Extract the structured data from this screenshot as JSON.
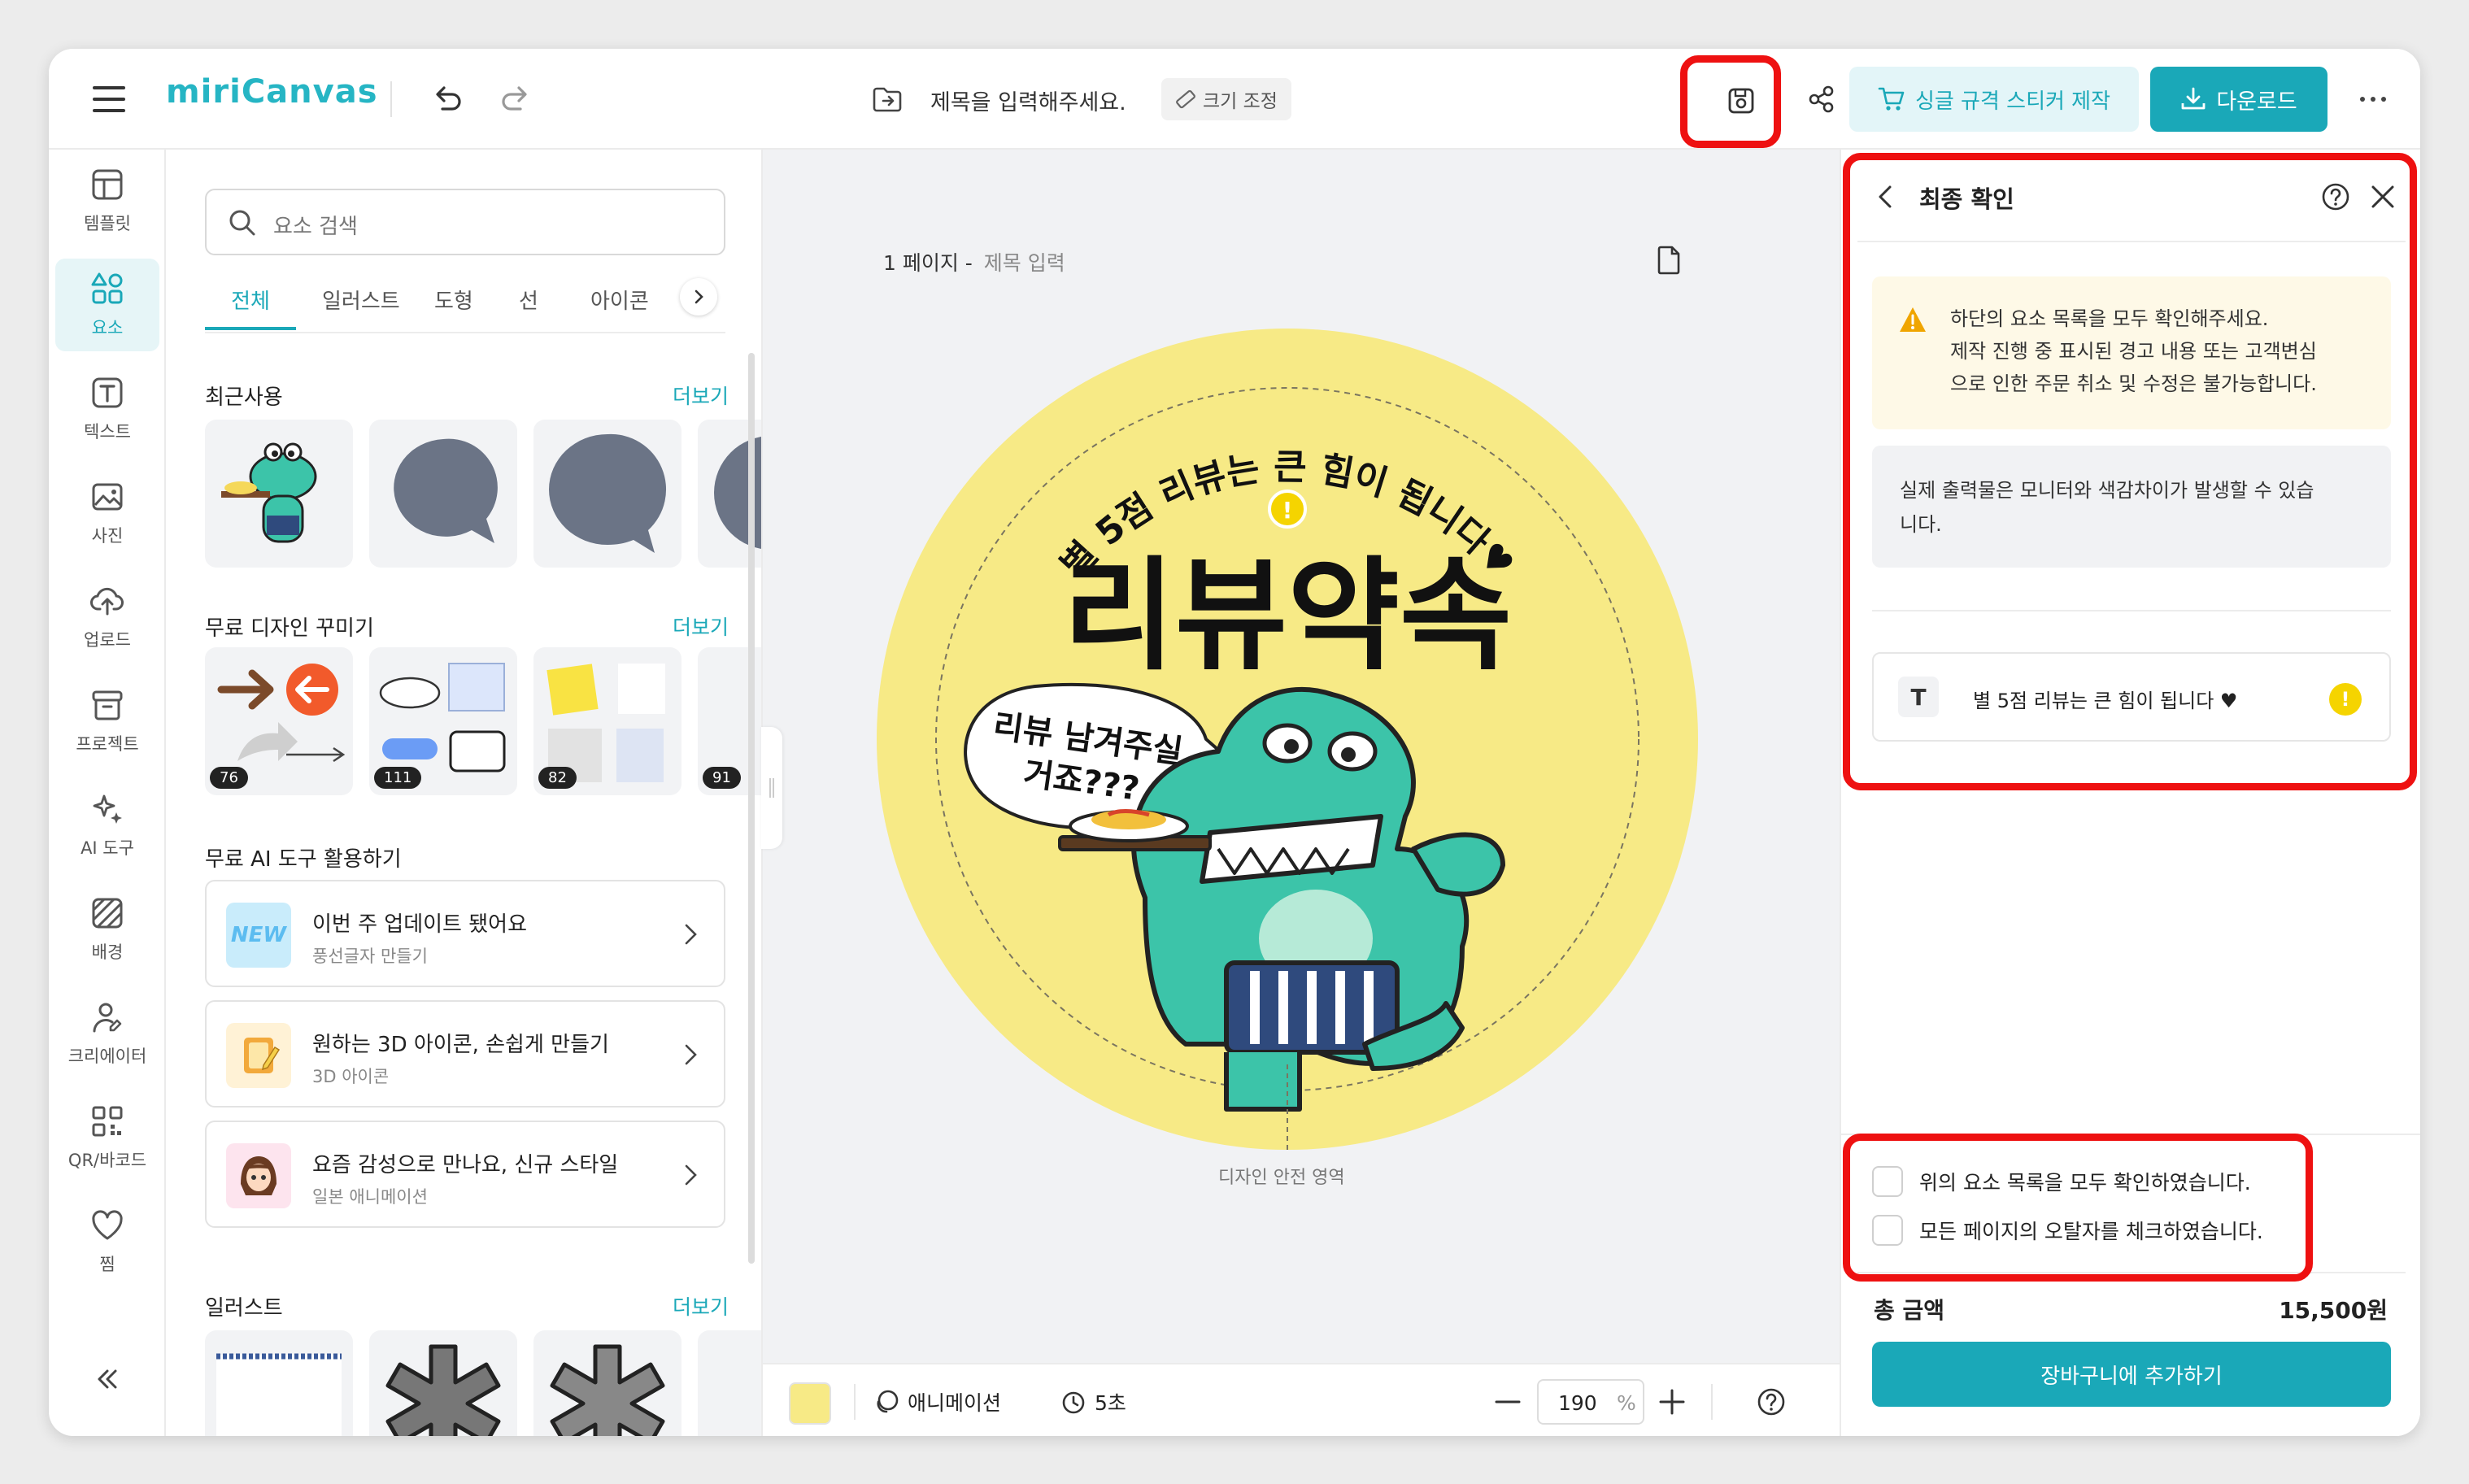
{
  "app": {
    "logo_text": "miriCanvas"
  },
  "header": {
    "title_placeholder": "제목을 입력해주세요.",
    "resize_label": "크기 조정",
    "sticker_button": "싱글 규격 스티커 제작",
    "download_button": "다운로드"
  },
  "sidebar": {
    "items": [
      {
        "label": "템플릿",
        "icon": "template-icon"
      },
      {
        "label": "요소",
        "icon": "elements-icon"
      },
      {
        "label": "텍스트",
        "icon": "text-icon"
      },
      {
        "label": "사진",
        "icon": "photo-icon"
      },
      {
        "label": "업로드",
        "icon": "upload-icon"
      },
      {
        "label": "프로젝트",
        "icon": "project-icon"
      },
      {
        "label": "AI 도구",
        "icon": "ai-sparkle-icon"
      },
      {
        "label": "배경",
        "icon": "background-icon"
      },
      {
        "label": "크리에이터",
        "icon": "creator-icon"
      },
      {
        "label": "QR/바코드",
        "icon": "qr-icon"
      },
      {
        "label": "찜",
        "icon": "heart-icon"
      }
    ]
  },
  "panel": {
    "search_placeholder": "요소 검색",
    "tabs": [
      "전체",
      "일러스트",
      "도형",
      "선",
      "아이콘"
    ],
    "more_label": "더보기",
    "recent_title": "최근사용",
    "free_deco_title": "무료 디자인 꾸미기",
    "deco_counts": [
      "76",
      "111",
      "82",
      "91"
    ],
    "ai_title": "무료 AI 도구 활용하기",
    "ai_cards": [
      {
        "title": "이번 주 업데이트 됐어요",
        "subtitle": "풍선글자 만들기",
        "thumb_text": "NEW"
      },
      {
        "title": "원하는 3D 아이콘, 손쉽게 만들기",
        "subtitle": "3D 아이콘"
      },
      {
        "title": "요즘 감성으로 만나요, 신규 스타일",
        "subtitle": "일본 애니메이션"
      }
    ],
    "illust_title": "일러스트"
  },
  "canvas": {
    "page_label": "1 페이지 -",
    "page_title_placeholder": "제목 입력",
    "sticker_arc_text": "별 5점 리뷰는 큰 힘이 됩니다♥",
    "sticker_main_text": "리뷰약속",
    "speech_line1": "리뷰 남겨주실",
    "speech_line2": "거죠???",
    "safe_area_label": "디자인 안전 영역",
    "sticker_color": "#f7ea86",
    "mascot_color": "#3cc4a9"
  },
  "bottombar": {
    "animation_label": "애니메이션",
    "duration_label": "5초",
    "zoom_value": "190",
    "zoom_unit": "%"
  },
  "right_panel": {
    "title": "최종 확인",
    "warning_line1": "하단의 요소 목록을 모두 확인해주세요.",
    "warning_line2": "제작 진행 중 표시된 경고 내용 또는 고객변심",
    "warning_line3": "으로 인한 주문 취소 및 수정은 불가능합니다.",
    "info_line1": "실제 출력물은 모니터와 색감차이가 발생할 수 있습",
    "info_line2": "니다.",
    "element_item_text": "별 5점 리뷰는 큰 힘이 됩니다 ♥",
    "check1": "위의 요소 목록을 모두 확인하였습니다.",
    "check2": "모든 페이지의 오탈자를 체크하였습니다.",
    "total_label": "총 금액",
    "total_value": "15,500원",
    "cart_button": "장바구니에 추가하기"
  },
  "colors": {
    "accent": "#1aa8b8",
    "highlight": "#ee1111",
    "warning": "#f0a500",
    "alert_dot": "#f5d400"
  }
}
